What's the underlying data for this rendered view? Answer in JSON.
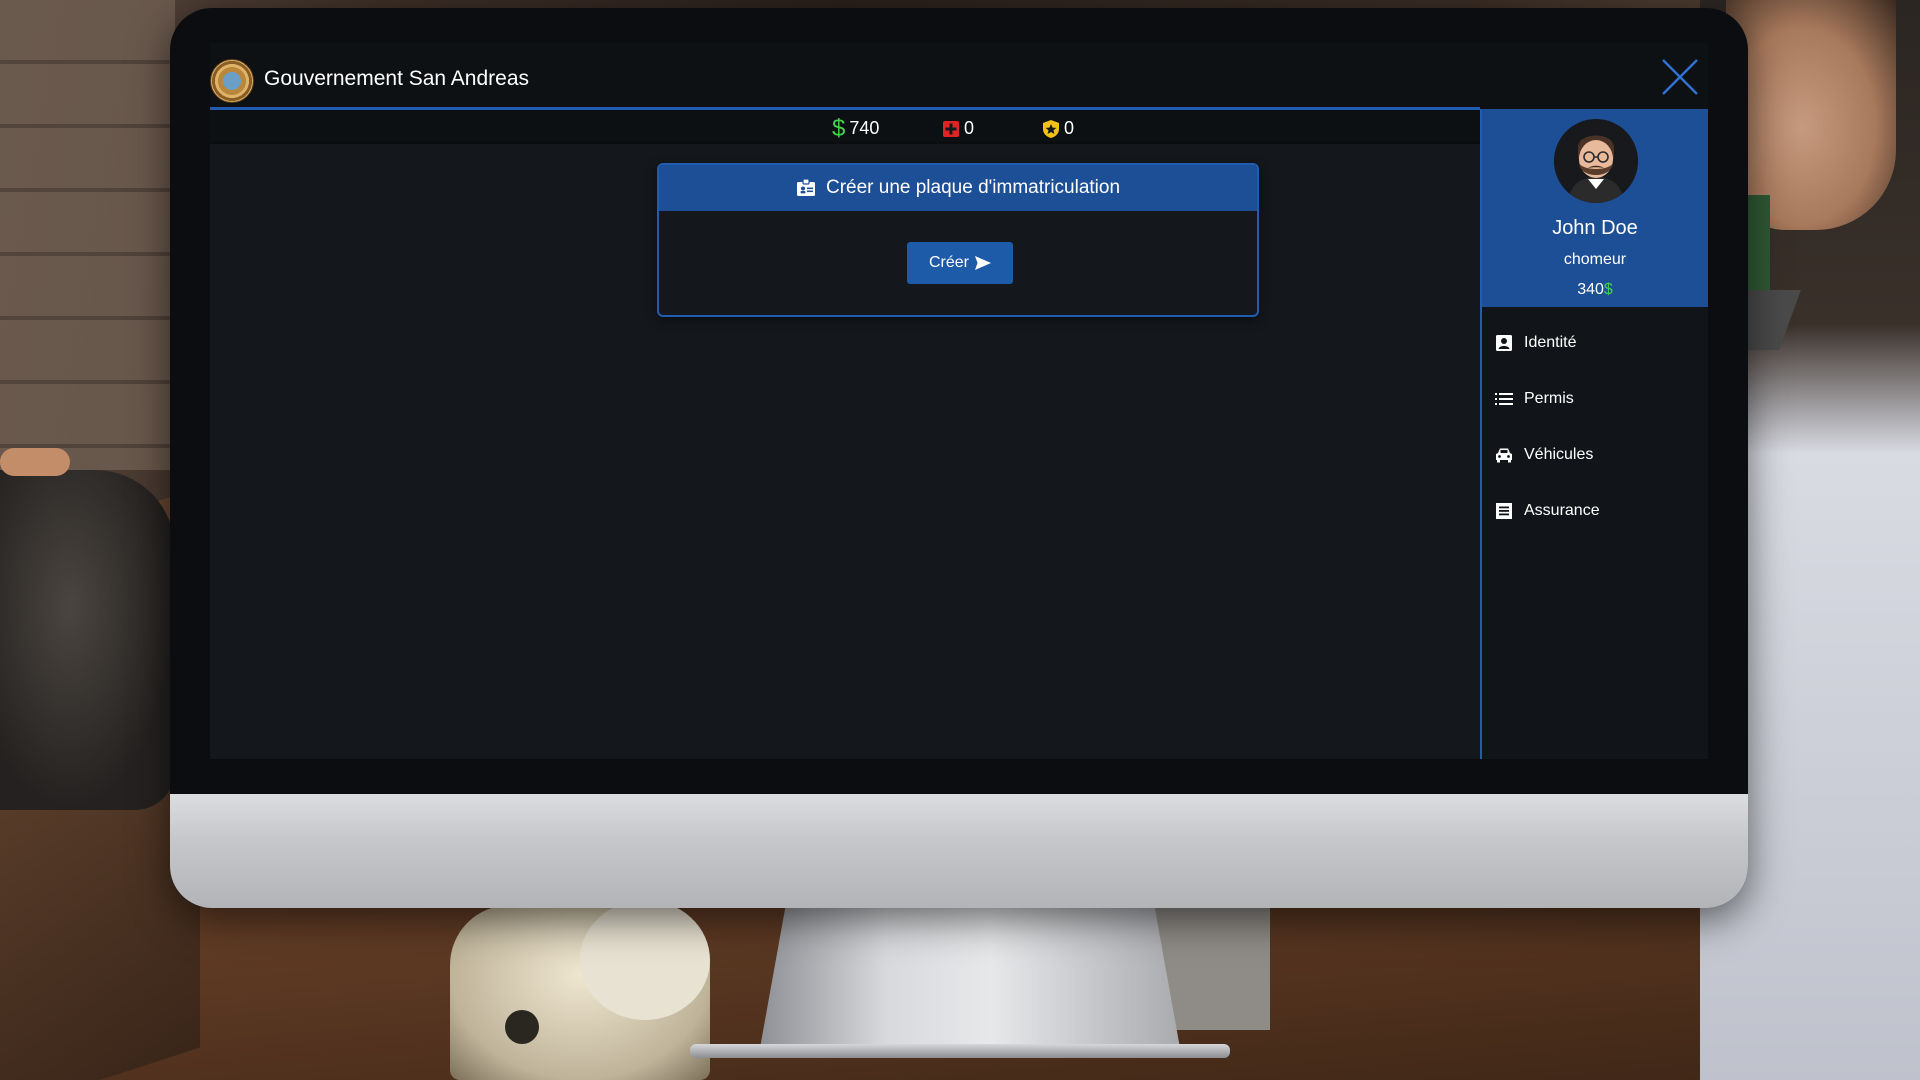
{
  "app": {
    "title": "Gouvernement San Andreas"
  },
  "stats": {
    "cash_symbol": "$",
    "cash": "740",
    "medic": "0",
    "police": "0"
  },
  "panel": {
    "title": "Créer une plaque d'immatriculation",
    "button_label": "Créer"
  },
  "profile": {
    "name": "John Doe",
    "job": "chomeur",
    "money": "340",
    "money_symbol": "$"
  },
  "menu": {
    "items": [
      {
        "label": "Identité",
        "icon": "id-card-icon"
      },
      {
        "label": "Permis",
        "icon": "list-icon"
      },
      {
        "label": "Véhicules",
        "icon": "car-icon"
      },
      {
        "label": "Assurance",
        "icon": "document-icon"
      }
    ]
  },
  "colors": {
    "accent": "#1f5cb2",
    "header_blue": "#1d4f96",
    "money_green": "#45d14b",
    "medic_red": "#e02424",
    "police_yellow": "#f2c21b",
    "background": "#14181d"
  }
}
